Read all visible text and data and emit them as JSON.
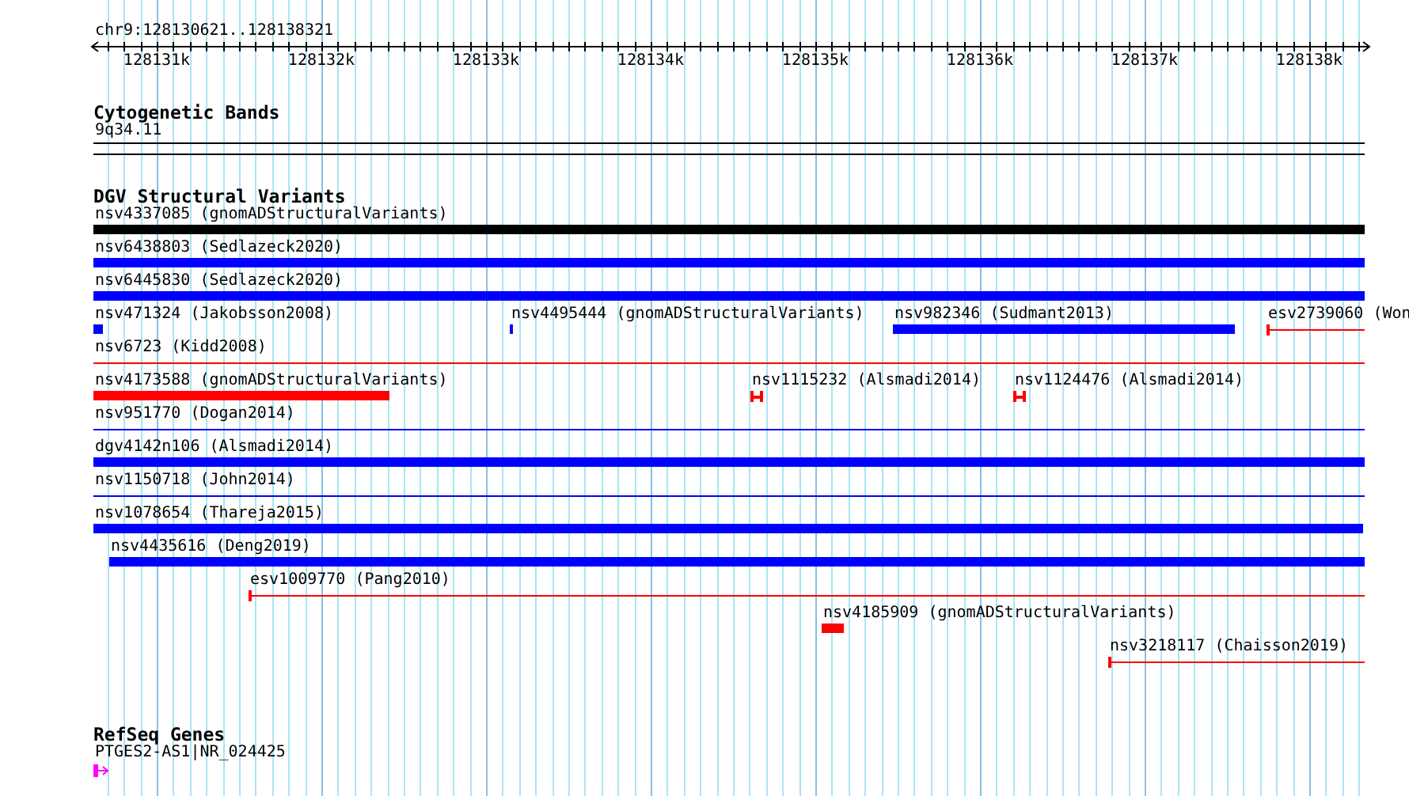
{
  "ruler": {
    "location": "chr9:128130621..128138321",
    "ticks": [
      "128131k",
      "128132k",
      "128133k",
      "128134k",
      "128135k",
      "128136k",
      "128137k",
      "128138k"
    ]
  },
  "cytogenetic_bands": {
    "title": "Cytogenetic Bands",
    "bands": [
      "9q34.11"
    ]
  },
  "dgv_structural_variants": {
    "title": "DGV Structural Variants",
    "rows": [
      {
        "features": [
          {
            "label": "nsv4337085 (gnomADStructuralVariants)",
            "kind": "bar",
            "color": "#000000"
          }
        ]
      },
      {
        "features": [
          {
            "label": "nsv6438803 (Sedlazeck2020)",
            "kind": "bar",
            "color": "#0000ff"
          }
        ]
      },
      {
        "features": [
          {
            "label": "nsv6445830 (Sedlazeck2020)",
            "kind": "bar",
            "color": "#0000ff"
          }
        ]
      },
      {
        "features": [
          {
            "label": "nsv471324 (Jakobsson2008)",
            "kind": "bar",
            "color": "#0000ff"
          },
          {
            "label": "nsv4495444 (gnomADStructuralVariants)",
            "kind": "bar",
            "color": "#0000ff"
          },
          {
            "label": "nsv982346 (Sudmant2013)",
            "kind": "bar",
            "color": "#0000ff"
          },
          {
            "label": "esv2739060 (Won",
            "kind": "line",
            "color": "#ff0000"
          }
        ]
      },
      {
        "features": [
          {
            "label": "nsv6723 (Kidd2008)",
            "kind": "line",
            "color": "#ff0000"
          }
        ]
      },
      {
        "features": [
          {
            "label": "nsv4173588 (gnomADStructuralVariants)",
            "kind": "bar",
            "color": "#ff0000"
          },
          {
            "label": "nsv1115232 (Alsmadi2014)",
            "kind": "marker",
            "color": "#ff0000"
          },
          {
            "label": "nsv1124476 (Alsmadi2014)",
            "kind": "marker",
            "color": "#ff0000"
          }
        ]
      },
      {
        "features": [
          {
            "label": "nsv951770 (Dogan2014)",
            "kind": "line",
            "color": "#0000ff"
          }
        ]
      },
      {
        "features": [
          {
            "label": "dgv4142n106 (Alsmadi2014)",
            "kind": "bar",
            "color": "#0000ff"
          }
        ]
      },
      {
        "features": [
          {
            "label": "nsv1150718 (John2014)",
            "kind": "line",
            "color": "#0000ff"
          }
        ]
      },
      {
        "features": [
          {
            "label": "nsv1078654 (Thareja2015)",
            "kind": "bar",
            "color": "#0000ff"
          }
        ]
      },
      {
        "features": [
          {
            "label": "nsv4435616 (Deng2019)",
            "kind": "bar",
            "color": "#0000ff"
          }
        ]
      },
      {
        "features": [
          {
            "label": "esv1009770 (Pang2010)",
            "kind": "line",
            "color": "#ff0000"
          }
        ]
      },
      {
        "features": [
          {
            "label": "nsv4185909 (gnomADStructuralVariants)",
            "kind": "bar",
            "color": "#ff0000"
          }
        ]
      },
      {
        "features": [
          {
            "label": "nsv3218117 (Chaisson2019)",
            "kind": "line",
            "color": "#ff0000"
          }
        ]
      }
    ]
  },
  "refseq_genes": {
    "title": "RefSeq Genes",
    "genes": [
      {
        "label": "PTGES2-AS1|NR_024425",
        "color": "#ff00ff"
      }
    ]
  }
}
